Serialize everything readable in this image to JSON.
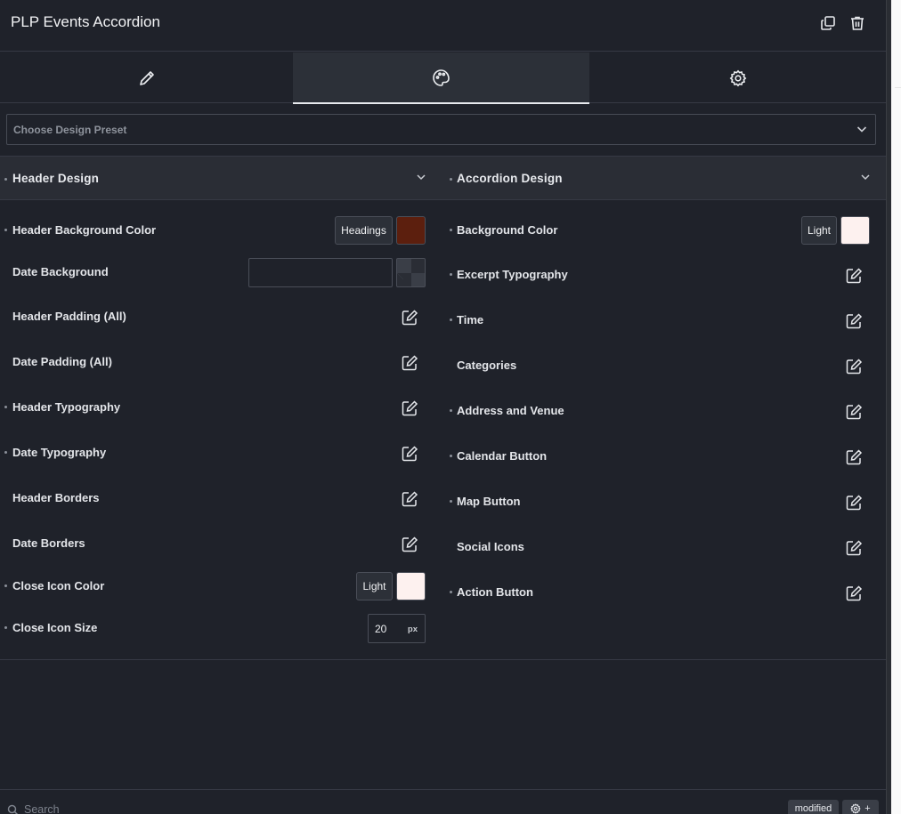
{
  "header": {
    "title": "PLP Events Accordion"
  },
  "tabs": [
    {
      "name": "content",
      "icon": "pencil-icon",
      "active": false
    },
    {
      "name": "style",
      "icon": "palette-icon",
      "active": true
    },
    {
      "name": "advanced",
      "icon": "gear-icon",
      "active": false
    }
  ],
  "preset": {
    "label": "Choose Design Preset"
  },
  "sections": {
    "header_design": {
      "title": "Header Design"
    },
    "accordion_design": {
      "title": "Accordion Design"
    }
  },
  "left_rows": {
    "header_bg": {
      "label": "Header Background Color",
      "chip": "Headings",
      "color": "#5c1f0e"
    },
    "date_bg": {
      "label": "Date Background"
    },
    "header_padding": {
      "label": "Header Padding (All)"
    },
    "date_padding": {
      "label": "Date Padding (All)"
    },
    "header_typo": {
      "label": "Header Typography"
    },
    "date_typo": {
      "label": "Date Typography"
    },
    "header_borders": {
      "label": "Header Borders"
    },
    "date_borders": {
      "label": "Date Borders"
    },
    "close_color": {
      "label": "Close Icon Color",
      "chip": "Light",
      "color": "#fdf1ef"
    },
    "close_size": {
      "label": "Close Icon Size",
      "value": "20",
      "unit": "px"
    }
  },
  "right_rows": {
    "bg_color": {
      "label": "Background Color",
      "chip": "Light",
      "color": "#fdf1ef"
    },
    "excerpt_typo": {
      "label": "Excerpt Typography"
    },
    "time": {
      "label": "Time"
    },
    "categories": {
      "label": "Categories"
    },
    "address": {
      "label": "Address and Venue"
    },
    "calendar_btn": {
      "label": "Calendar Button"
    },
    "map_btn": {
      "label": "Map Button"
    },
    "social_icons": {
      "label": "Social Icons"
    },
    "action_btn": {
      "label": "Action Button"
    }
  },
  "footer": {
    "search_placeholder": "Search",
    "modified_label": "modified",
    "add_label": "+"
  }
}
